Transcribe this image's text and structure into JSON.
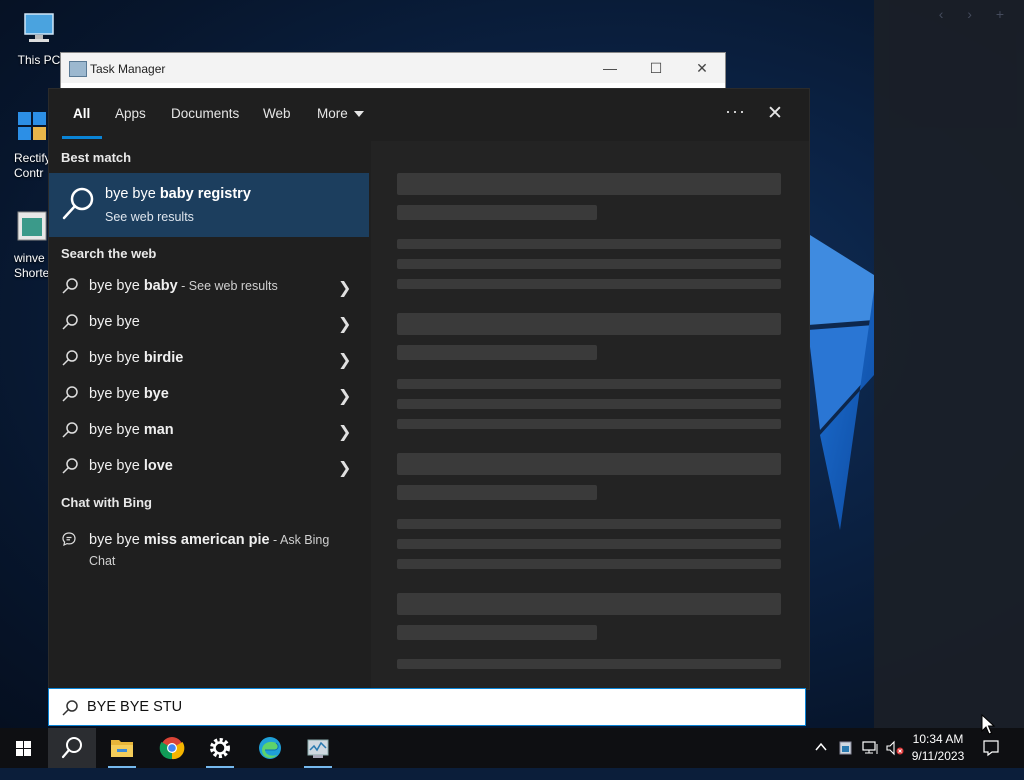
{
  "desktop": {
    "icons": [
      {
        "label": "This PC"
      },
      {
        "label": "Rectify Contr"
      },
      {
        "label": "winve Shorte"
      }
    ]
  },
  "task_manager": {
    "title": "Task Manager"
  },
  "search_panel": {
    "tabs": [
      {
        "label": "All"
      },
      {
        "label": "Apps"
      },
      {
        "label": "Documents"
      },
      {
        "label": "Web"
      },
      {
        "label": "More"
      }
    ],
    "options_label": "···",
    "close_label": "✕",
    "best_match_heading": "Best match",
    "best_match": {
      "prefix": "bye bye ",
      "bold": "baby registry",
      "subtitle": "See web results"
    },
    "web_heading": "Search the web",
    "web_results": [
      {
        "prefix": "bye bye ",
        "bold": "baby",
        "suffix": " - See web results"
      },
      {
        "prefix": "bye bye",
        "bold": "",
        "suffix": ""
      },
      {
        "prefix": "bye bye ",
        "bold": "birdie",
        "suffix": ""
      },
      {
        "prefix": "bye bye ",
        "bold": "bye",
        "suffix": ""
      },
      {
        "prefix": "bye bye ",
        "bold": "man",
        "suffix": ""
      },
      {
        "prefix": "bye bye ",
        "bold": "love",
        "suffix": ""
      }
    ],
    "bing_heading": "Chat with Bing",
    "bing_result": {
      "prefix": "bye bye ",
      "bold": "miss american pie",
      "suffix": " - Ask Bing Chat"
    },
    "query": "BYE BYE STU"
  },
  "taskbar": {
    "apps": [
      "start-icon",
      "search-icon",
      "file-explorer-icon",
      "chrome-icon",
      "settings-icon",
      "edge-icon",
      "task-manager-icon"
    ],
    "time": "10:34 AM",
    "date": "9/11/2023"
  },
  "colors": {
    "accent": "#0a84d6",
    "best_match_bg": "#1c3e5e",
    "flyout_bg": "#1f1f1f"
  }
}
